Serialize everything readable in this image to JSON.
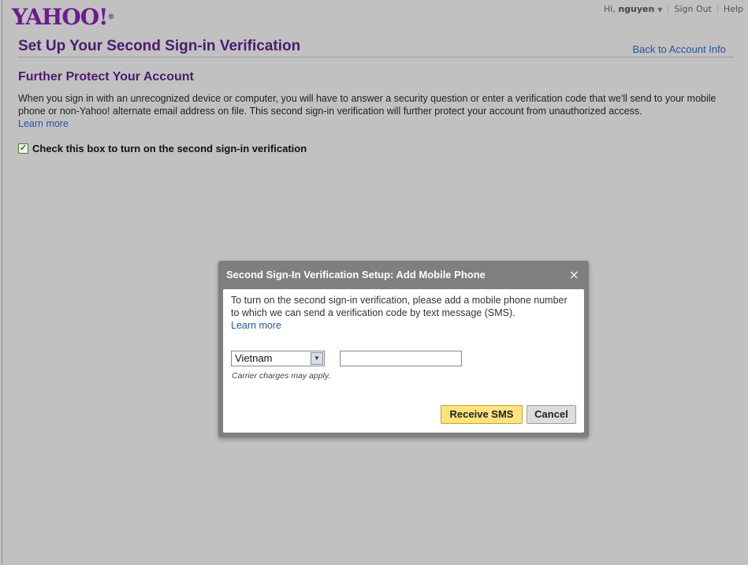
{
  "logo": {
    "text": "YAHOO!",
    "mark": "®"
  },
  "topnav": {
    "greeting_prefix": "Hi,",
    "username": "nguyen",
    "sign_out": "Sign Out",
    "help": "Help"
  },
  "page": {
    "title": "Set Up Your Second Sign-in Verification",
    "back_link": "Back to Account Info",
    "subtitle": "Further Protect Your Account",
    "description": "When you sign in with an unrecognized device or computer, you will have to answer a security question or enter a verification code that we'll send to your mobile phone or non-Yahoo! alternate email address on file. This second sign-in verification will further protect your account from unauthorized access.",
    "learn_more": "Learn more",
    "checkbox_label": "Check this box to turn on the second sign-in verification",
    "checkbox_checked": true
  },
  "dialog": {
    "title": "Second Sign-In Verification Setup: Add Mobile Phone",
    "close": "×",
    "text": "To turn on the second sign-in verification, please add a mobile phone number to which we can send a verification code by text message (SMS).",
    "learn_more": "Learn more",
    "country": "Vietnam",
    "phone_value": "",
    "carrier_note": "Carrier charges may apply.",
    "receive_sms": "Receive SMS",
    "cancel": "Cancel"
  },
  "colors": {
    "background": "#c1c1c1",
    "brand": "#6e1a8f",
    "link": "#24569a",
    "primary_button": "#fde37d"
  }
}
